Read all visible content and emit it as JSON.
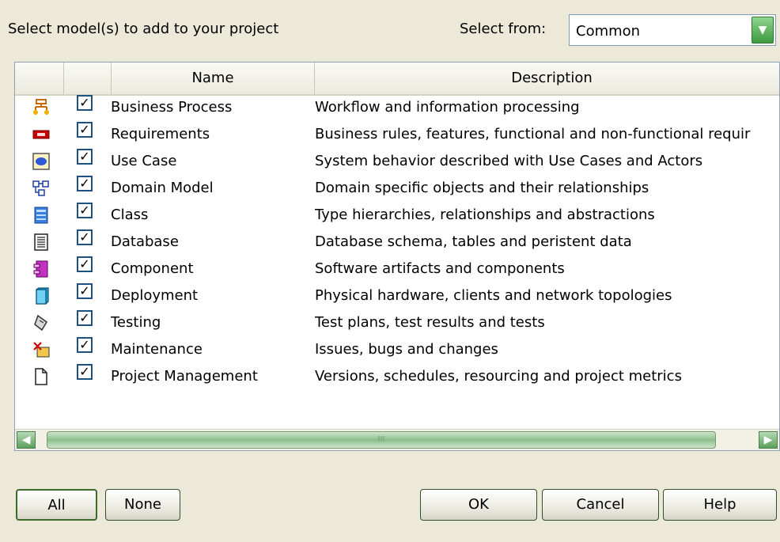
{
  "dialog": {
    "prompt": "Select model(s) to add to your project",
    "select_label": "Select from:",
    "select_value": "Common"
  },
  "table": {
    "columns": {
      "icon": "",
      "check": "",
      "name": "Name",
      "description": "Description"
    },
    "rows": [
      {
        "icon": "business-process-icon",
        "checked": true,
        "name": "Business Process",
        "description": "Workflow and information processing"
      },
      {
        "icon": "requirements-icon",
        "checked": true,
        "name": "Requirements",
        "description": "Business rules, features, functional and non-functional requir"
      },
      {
        "icon": "use-case-icon",
        "checked": true,
        "name": "Use Case",
        "description": "System behavior described with Use Cases and Actors"
      },
      {
        "icon": "domain-model-icon",
        "checked": true,
        "name": "Domain Model",
        "description": "Domain specific objects and their relationships"
      },
      {
        "icon": "class-icon",
        "checked": true,
        "name": "Class",
        "description": "Type hierarchies, relationships and abstractions"
      },
      {
        "icon": "database-icon",
        "checked": true,
        "name": "Database",
        "description": "Database schema, tables and peristent data"
      },
      {
        "icon": "component-icon",
        "checked": true,
        "name": "Component",
        "description": "Software artifacts and components"
      },
      {
        "icon": "deployment-icon",
        "checked": true,
        "name": "Deployment",
        "description": "Physical hardware, clients and network topologies"
      },
      {
        "icon": "testing-icon",
        "checked": true,
        "name": "Testing",
        "description": "Test plans, test results and tests"
      },
      {
        "icon": "maintenance-icon",
        "checked": true,
        "name": "Maintenance",
        "description": "Issues, bugs and changes"
      },
      {
        "icon": "project-management-icon",
        "checked": true,
        "name": "Project Management",
        "description": "Versions, schedules, resourcing and project metrics"
      }
    ]
  },
  "scrollbar": {
    "thumb_grip": "III"
  },
  "buttons": {
    "all": "All",
    "none": "None",
    "ok": "OK",
    "cancel": "Cancel",
    "help": "Help"
  },
  "colors": {
    "accent_green": "#5aa05a",
    "check_border": "#1c5180"
  }
}
